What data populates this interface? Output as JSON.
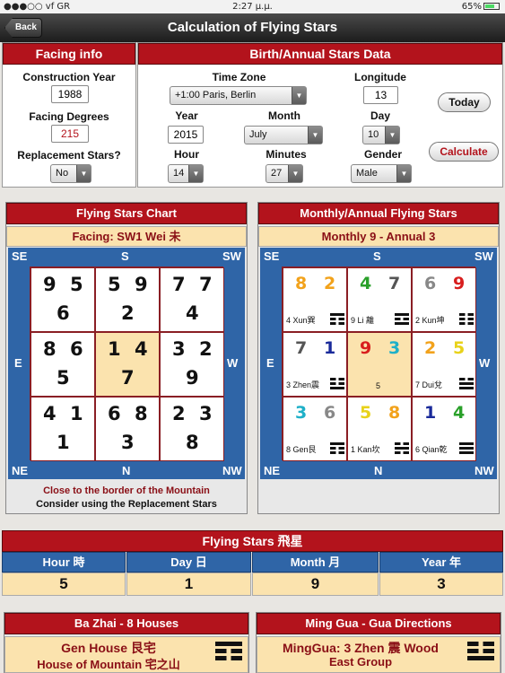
{
  "status": {
    "carrier": "●●●○○ vf GR",
    "time": "2:27 μ.μ.",
    "battery": "65%"
  },
  "nav": {
    "back": "Back",
    "title": "Calculation of Flying Stars"
  },
  "facing_info": {
    "header": "Facing info",
    "construction_year_label": "Construction Year",
    "construction_year": "1988",
    "facing_degrees_label": "Facing Degrees",
    "facing_degrees": "215",
    "replacement_label": "Replacement Stars?",
    "replacement": "No"
  },
  "birth": {
    "header": "Birth/Annual Stars Data",
    "timezone_label": "Time Zone",
    "timezone": "+1:00 Paris, Berlin",
    "longitude_label": "Longitude",
    "longitude": "13",
    "year_label": "Year",
    "year": "2015",
    "month_label": "Month",
    "month": "July",
    "day_label": "Day",
    "day": "10",
    "hour_label": "Hour",
    "hour": "14",
    "minutes_label": "Minutes",
    "minutes": "27",
    "gender_label": "Gender",
    "gender": "Male",
    "today_button": "Today",
    "calculate_button": "Calculate"
  },
  "chart": {
    "header": "Flying Stars Chart",
    "facing": "Facing: SW1 Wei 未",
    "dirs": {
      "se": "SE",
      "s": "S",
      "sw": "SW",
      "e": "E",
      "w": "W",
      "ne": "NE",
      "n": "N",
      "nw": "NW"
    },
    "cells": [
      {
        "a": "9",
        "b": "5",
        "c": "6"
      },
      {
        "a": "5",
        "b": "9",
        "c": "2"
      },
      {
        "a": "7",
        "b": "7",
        "c": "4"
      },
      {
        "a": "8",
        "b": "6",
        "c": "5"
      },
      {
        "a": "1",
        "b": "4",
        "c": "7"
      },
      {
        "a": "3",
        "b": "2",
        "c": "9"
      },
      {
        "a": "4",
        "b": "1",
        "c": "1"
      },
      {
        "a": "6",
        "b": "8",
        "c": "3"
      },
      {
        "a": "2",
        "b": "3",
        "c": "8"
      }
    ],
    "note_line1": "Close to the border of the Mountain",
    "note_line2": "Consider using the Replacement Stars"
  },
  "monthly": {
    "header": "Monthly/Annual Flying Stars",
    "subtitle": "Monthly 9 - Annual 3",
    "dirs": {
      "se": "SE",
      "s": "S",
      "sw": "SW",
      "e": "E",
      "w": "W",
      "ne": "NE",
      "n": "N",
      "nw": "NW"
    },
    "cells": [
      {
        "m": "8",
        "mc": "#f2a21b",
        "a": "2",
        "ac": "#f2a21b",
        "tri": "4 Xun巽"
      },
      {
        "m": "4",
        "mc": "#2aa02a",
        "a": "7",
        "ac": "#555555",
        "tri": "9 Li 離"
      },
      {
        "m": "6",
        "mc": "#888888",
        "a": "9",
        "ac": "#d81e1e",
        "tri": "2 Kun坤"
      },
      {
        "m": "7",
        "mc": "#555555",
        "a": "1",
        "ac": "#1a2a9a",
        "tri": "3 Zhen震"
      },
      {
        "m": "9",
        "mc": "#d81e1e",
        "a": "3",
        "ac": "#1fb0c8",
        "tri": "5"
      },
      {
        "m": "2",
        "mc": "#f2a21b",
        "a": "5",
        "ac": "#e8d21a",
        "tri": "7 Dui兌"
      },
      {
        "m": "3",
        "mc": "#1fb0c8",
        "a": "6",
        "ac": "#888888",
        "tri": "8 Gen艮"
      },
      {
        "m": "5",
        "mc": "#e8d21a",
        "a": "8",
        "ac": "#f2a21b",
        "tri": "1 Kan坎"
      },
      {
        "m": "1",
        "mc": "#1a2a9a",
        "a": "4",
        "ac": "#2aa02a",
        "tri": "6 Qian乾"
      }
    ]
  },
  "flying_stars": {
    "header": "Flying Stars 飛星",
    "cols": [
      {
        "label": "Hour 時",
        "value": "5"
      },
      {
        "label": "Day 日",
        "value": "1"
      },
      {
        "label": "Month 月",
        "value": "9"
      },
      {
        "label": "Year 年",
        "value": "3"
      }
    ]
  },
  "ba_zhai": {
    "header": "Ba Zhai - 8 Houses",
    "line1": "Gen House 艮宅",
    "line2": "House of Mountain 宅之山"
  },
  "ming_gua": {
    "header": "Ming Gua - Gua Directions",
    "line1": "MingGua: 3 Zhen 震 Wood",
    "line2": "East Group"
  },
  "colors": {
    "accent_red": "#b3131c",
    "chart_blue": "#2f65a7",
    "cell_yellow": "#fbe3ae"
  }
}
